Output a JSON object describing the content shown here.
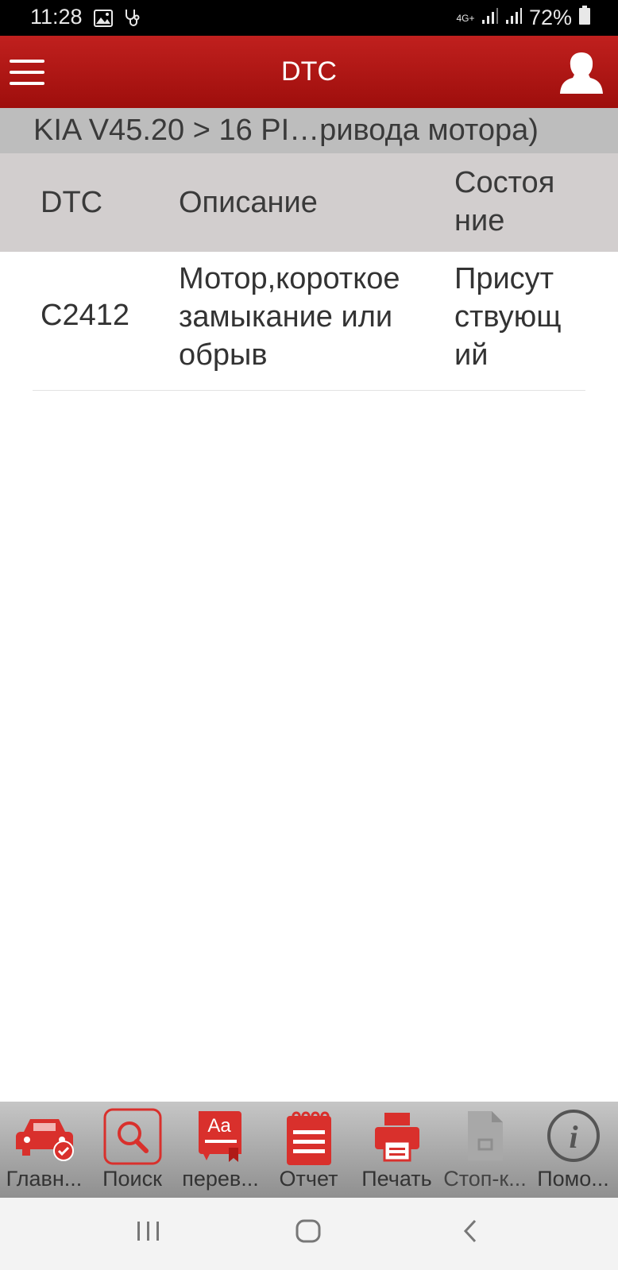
{
  "status_bar": {
    "time": "11:28",
    "network": "4G+",
    "battery": "72%",
    "icons": [
      "image-icon",
      "stethoscope-icon",
      "signal-icon",
      "signal-icon",
      "battery-icon"
    ]
  },
  "app_bar": {
    "title": "DTC",
    "menu_icon": "hamburger-menu-icon",
    "user_icon": "user-profile-icon",
    "background": "#b11513"
  },
  "breadcrumb": "KIA V45.20 > 16 PI…ривода мотора)",
  "table": {
    "headers": {
      "dtc": "DTC",
      "description": "Описание",
      "status_line1": "Состоя",
      "status_line2": "ние"
    },
    "rows": [
      {
        "code": "C2412",
        "desc_line1": "Мотор,короткое",
        "desc_line2": "замыкание или",
        "desc_line3": "обрыв",
        "status_line1": "Присут",
        "status_line2": "ствующ",
        "status_line3": "ий"
      }
    ]
  },
  "toolbar": {
    "items": [
      {
        "label": "Главн...",
        "icon": "car-check-icon"
      },
      {
        "label": "Поиск",
        "icon": "search-icon"
      },
      {
        "label": "перев...",
        "icon": "translate-book-icon"
      },
      {
        "label": "Отчет",
        "icon": "report-notepad-icon"
      },
      {
        "label": "Печать",
        "icon": "printer-icon"
      },
      {
        "label": "Стоп-к...",
        "icon": "document-icon",
        "disabled": true
      },
      {
        "label": "Помо...",
        "icon": "info-icon"
      }
    ],
    "accent": "#d9302c"
  },
  "nav_bar": {
    "icons": [
      "recent-apps-icon",
      "home-icon",
      "back-icon"
    ]
  }
}
